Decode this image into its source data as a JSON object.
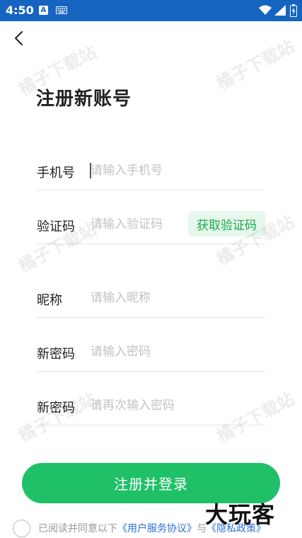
{
  "status_bar": {
    "time": "4:50",
    "a_badge": "A",
    "icons": [
      "notification-a-icon",
      "keyboard-icon",
      "wifi-icon",
      "signal-icon",
      "battery-icon"
    ]
  },
  "nav": {
    "back_icon": "chevron-left-icon"
  },
  "page": {
    "title": "注册新账号"
  },
  "form": {
    "phone": {
      "label": "手机号",
      "placeholder": "请输入手机号",
      "value": ""
    },
    "code": {
      "label": "验证码",
      "placeholder": "请输入验证码",
      "value": "",
      "button_label": "获取验证码"
    },
    "nickname": {
      "label": "昵称",
      "placeholder": "请输入昵称",
      "value": ""
    },
    "password": {
      "label": "新密码",
      "placeholder": "请输入密码",
      "value": ""
    },
    "password_confirm": {
      "label": "新密码",
      "placeholder": "请再次输入密码",
      "value": ""
    }
  },
  "submit": {
    "label": "注册并登录"
  },
  "agreement": {
    "prefix": "已阅读并同意以下",
    "user_agreement": "《用户服务协议》",
    "conjunction": "与",
    "privacy_policy": "《隐私政策》",
    "checked": false
  },
  "watermark": {
    "text": "橘子下载站"
  },
  "corner_logo": {
    "text": "大玩客"
  },
  "colors": {
    "status_bar": "#1565c0",
    "primary_green": "#20c068",
    "code_button_bg": "#e6f7ec",
    "code_button_text": "#1aaa50",
    "link": "#2f6fd6"
  }
}
